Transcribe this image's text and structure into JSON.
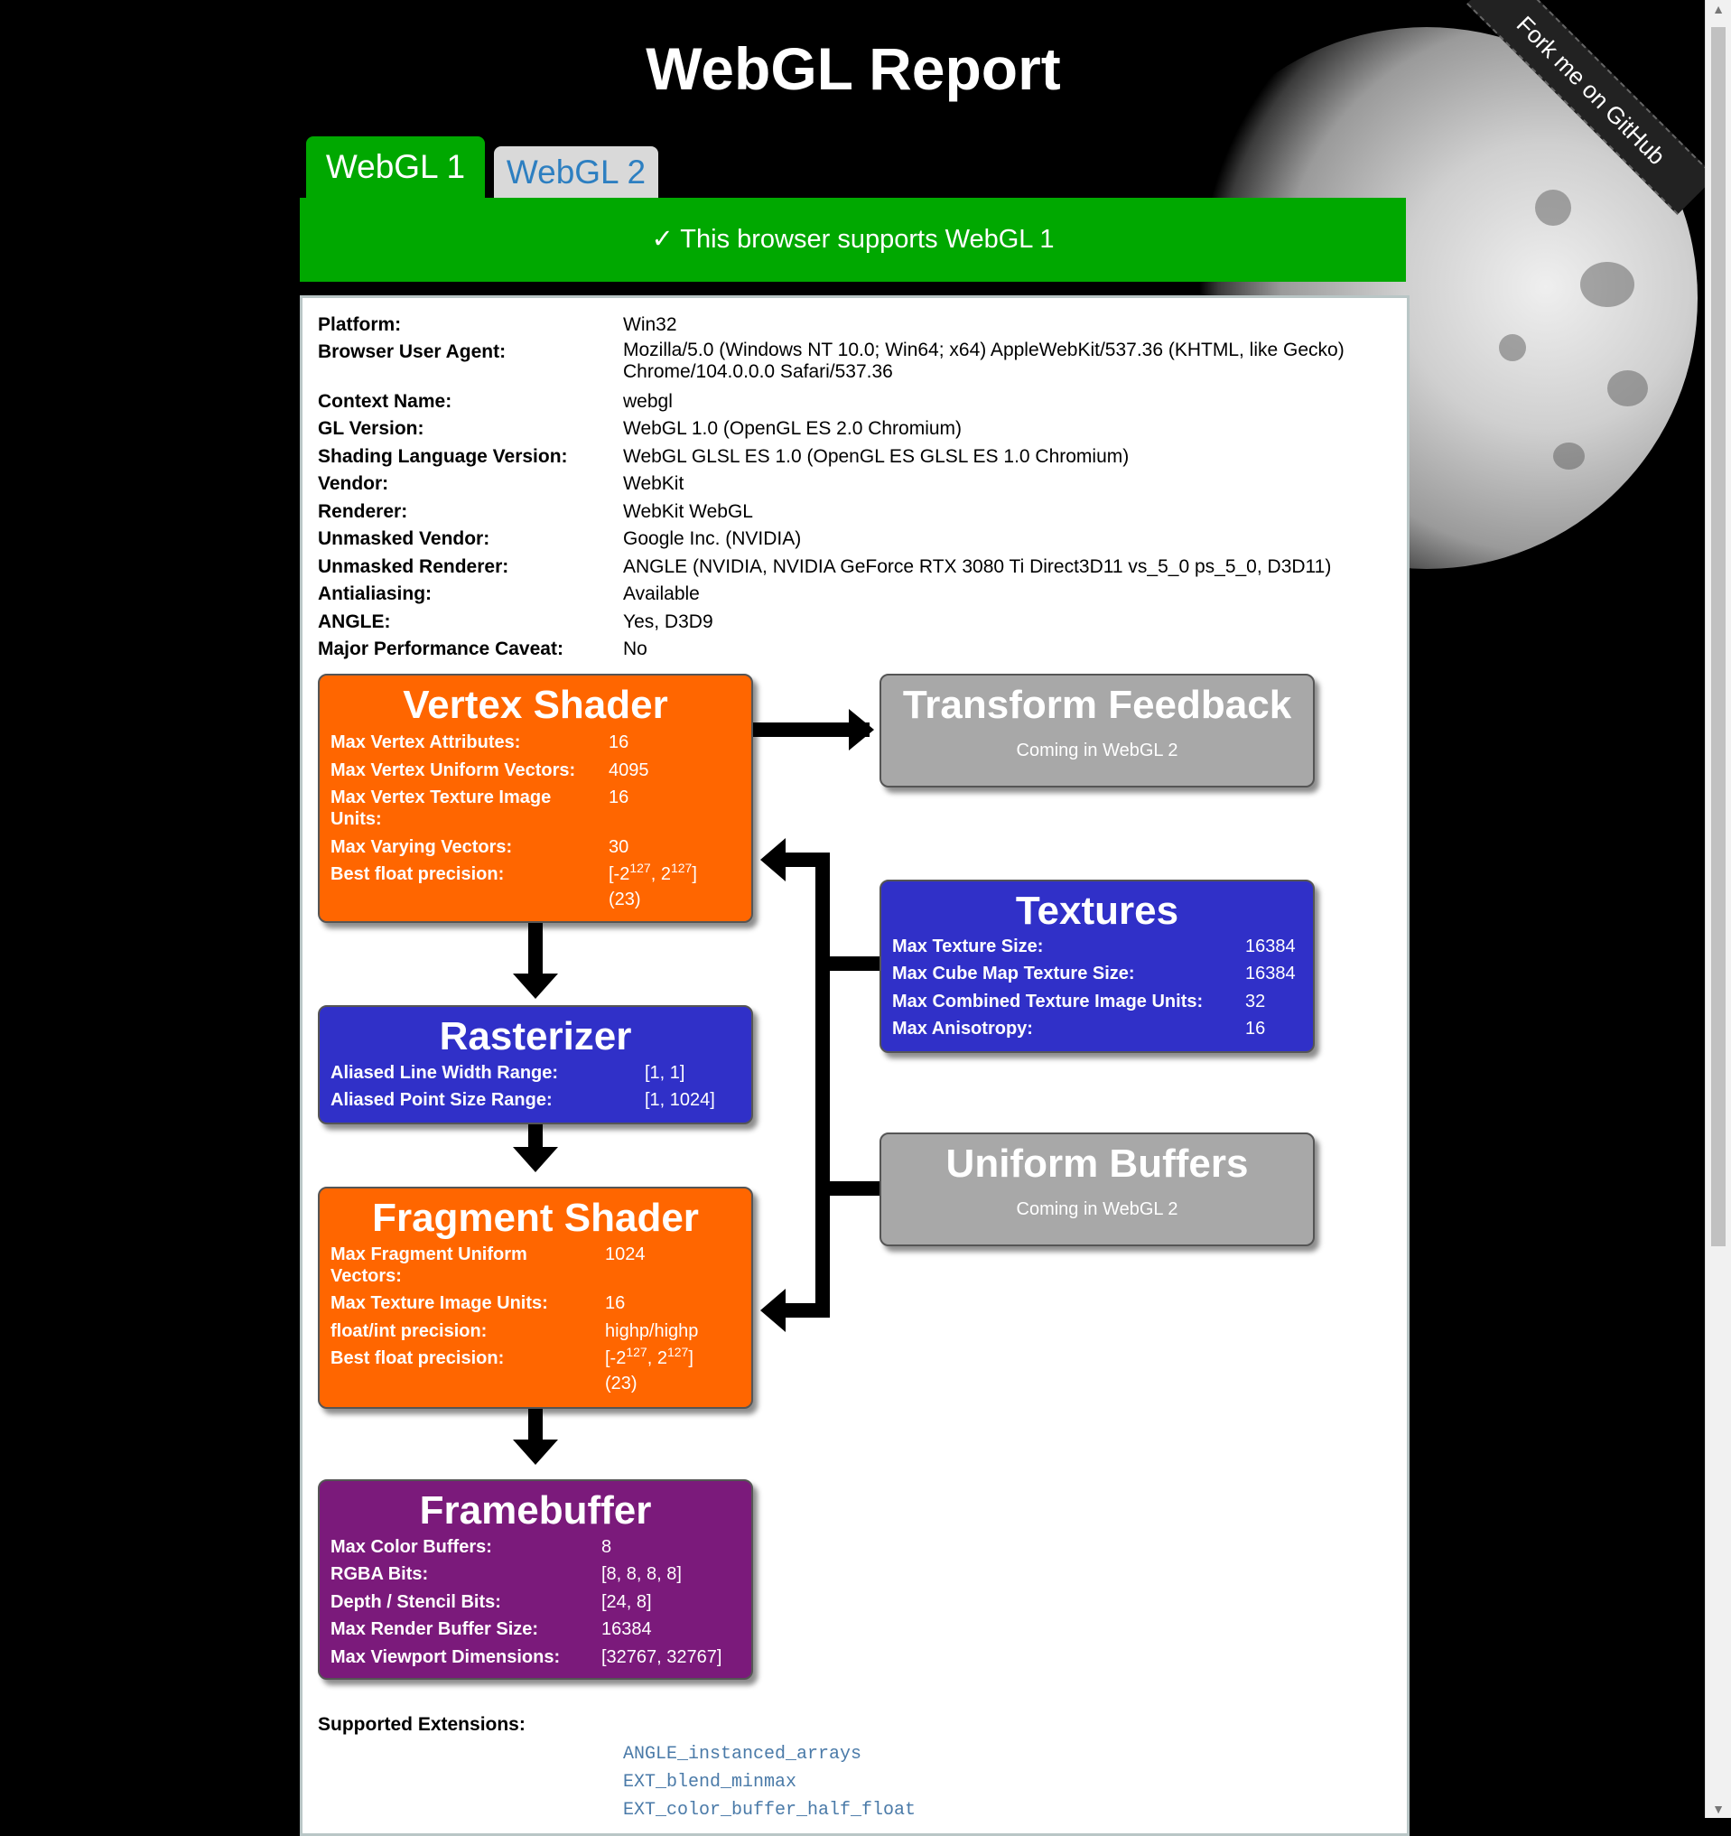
{
  "page": {
    "title": "WebGL Report",
    "ribbon": "Fork me on GitHub"
  },
  "tabs": [
    {
      "label": "WebGL 1",
      "active": true
    },
    {
      "label": "WebGL 2",
      "active": false
    }
  ],
  "banner": "✓ This browser supports WebGL 1",
  "info": [
    {
      "label": "Platform:",
      "value": "Win32"
    },
    {
      "label": "Browser User Agent:",
      "value": "Mozilla/5.0 (Windows NT 10.0; Win64; x64) AppleWebKit/537.36 (KHTML, like Gecko) Chrome/104.0.0.0 Safari/537.36"
    },
    {
      "label": "Context Name:",
      "value": "webgl"
    },
    {
      "label": "GL Version:",
      "value": "WebGL 1.0 (OpenGL ES 2.0 Chromium)"
    },
    {
      "label": "Shading Language Version:",
      "value": "WebGL GLSL ES 1.0 (OpenGL ES GLSL ES 1.0 Chromium)"
    },
    {
      "label": "Vendor:",
      "value": "WebKit"
    },
    {
      "label": "Renderer:",
      "value": "WebKit WebGL"
    },
    {
      "label": "Unmasked Vendor:",
      "value": "Google Inc. (NVIDIA)"
    },
    {
      "label": "Unmasked Renderer:",
      "value": "ANGLE (NVIDIA, NVIDIA GeForce RTX 3080 Ti Direct3D11 vs_5_0 ps_5_0, D3D11)"
    },
    {
      "label": "Antialiasing:",
      "value": "Available"
    },
    {
      "label": "ANGLE:",
      "value": "Yes, D3D9"
    },
    {
      "label": "Major Performance Caveat:",
      "value": "No"
    }
  ],
  "vertex": {
    "title": "Vertex Shader",
    "rows": [
      {
        "label": "Max Vertex Attributes:",
        "value": "16"
      },
      {
        "label": "Max Vertex Uniform Vectors:",
        "value": "4095"
      },
      {
        "label": "Max Vertex Texture Image Units:",
        "value": "16"
      },
      {
        "label": "Max Varying Vectors:",
        "value": "30"
      },
      {
        "label": "Best float precision:",
        "value_a": "[-2",
        "exp1": "127",
        "value_b": ", 2",
        "exp2": "127",
        "value_c": "]",
        "value_d": "(23)"
      }
    ]
  },
  "transform": {
    "title": "Transform Feedback",
    "note": "Coming in WebGL 2"
  },
  "rasterizer": {
    "title": "Rasterizer",
    "rows": [
      {
        "label": "Aliased Line Width Range:",
        "value": "[1, 1]"
      },
      {
        "label": "Aliased Point Size Range:",
        "value": "[1, 1024]"
      }
    ]
  },
  "textures": {
    "title": "Textures",
    "rows": [
      {
        "label": "Max Texture Size:",
        "value": "16384"
      },
      {
        "label": "Max Cube Map Texture Size:",
        "value": "16384"
      },
      {
        "label": "Max Combined Texture Image Units:",
        "value": "32"
      },
      {
        "label": "Max Anisotropy:",
        "value": "16"
      }
    ]
  },
  "uniform": {
    "title": "Uniform Buffers",
    "note": "Coming in WebGL 2"
  },
  "fragment": {
    "title": "Fragment Shader",
    "rows": [
      {
        "label": "Max Fragment Uniform Vectors:",
        "value": "1024"
      },
      {
        "label": "Max Texture Image Units:",
        "value": "16"
      },
      {
        "label": "float/int precision:",
        "value": "highp/highp"
      },
      {
        "label": "Best float precision:",
        "value_a": "[-2",
        "exp1": "127",
        "value_b": ", 2",
        "exp2": "127",
        "value_c": "]",
        "value_d": "(23)"
      }
    ]
  },
  "framebuffer": {
    "title": "Framebuffer",
    "rows": [
      {
        "label": "Max Color Buffers:",
        "value": "8"
      },
      {
        "label": "RGBA Bits:",
        "value": "[8, 8, 8, 8]"
      },
      {
        "label": "Depth / Stencil Bits:",
        "value": "[24, 8]"
      },
      {
        "label": "Max Render Buffer Size:",
        "value": "16384"
      },
      {
        "label": "Max Viewport Dimensions:",
        "value": "[32767, 32767]"
      }
    ]
  },
  "extensions": {
    "label": "Supported Extensions:",
    "items": [
      "ANGLE_instanced_arrays",
      "EXT_blend_minmax",
      "EXT_color_buffer_half_float"
    ]
  },
  "colors": {
    "green": "#00a800",
    "orange": "#ff6600",
    "blue": "#3030c8",
    "gray": "#a8a8a8",
    "purple": "#7b1a7b"
  }
}
